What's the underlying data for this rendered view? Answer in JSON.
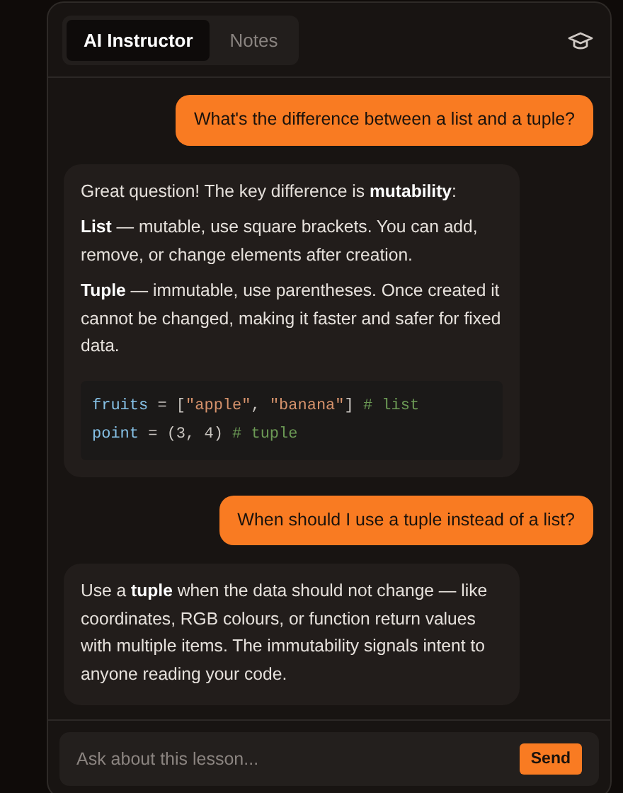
{
  "tabs": [
    {
      "label": "AI Instructor",
      "selected": true
    },
    {
      "label": "Notes",
      "selected": false
    }
  ],
  "messages": [
    {
      "kind": "user",
      "blocks": [
        {
          "kind": "paragraph",
          "text": "What's the difference between a list and a tuple?"
        }
      ]
    },
    {
      "kind": "assistant",
      "blocks": [
        {
          "kind": "paragraph",
          "text": "Great question! The key difference is **mutability**:"
        },
        {
          "kind": "paragraph",
          "text": "**List** — mutable, use square brackets. You can add, remove, or change elements after creation."
        },
        {
          "kind": "paragraph",
          "text": "**Tuple** — immutable, use parentheses. Once created it cannot be changed, making it faster and safer for fixed data."
        },
        {
          "kind": "code",
          "lines": [
            [
              {
                "kind": "name",
                "text": "fruits"
              },
              {
                "kind": "plain",
                "text": " = ["
              },
              {
                "kind": "string",
                "text": "\"apple\""
              },
              {
                "kind": "plain",
                "text": ", "
              },
              {
                "kind": "string",
                "text": "\"banana\""
              },
              {
                "kind": "plain",
                "text": "] "
              },
              {
                "kind": "comment",
                "text": "# list"
              }
            ],
            [
              {
                "kind": "name",
                "text": "point"
              },
              {
                "kind": "plain",
                "text": " = (3, 4) "
              },
              {
                "kind": "comment",
                "text": "# tuple"
              }
            ]
          ]
        }
      ]
    },
    {
      "kind": "user",
      "blocks": [
        {
          "kind": "paragraph",
          "text": "When should I use a tuple instead of a list?"
        }
      ]
    },
    {
      "kind": "assistant",
      "blocks": [
        {
          "kind": "paragraph",
          "text": "Use a **tuple** when the data should not change — like coordinates, RGB colours, or function return values with multiple items. The immutability signals intent to anyone reading your code."
        }
      ]
    }
  ],
  "composer": {
    "placeholder": "Ask about this lesson...",
    "button": "Send"
  }
}
